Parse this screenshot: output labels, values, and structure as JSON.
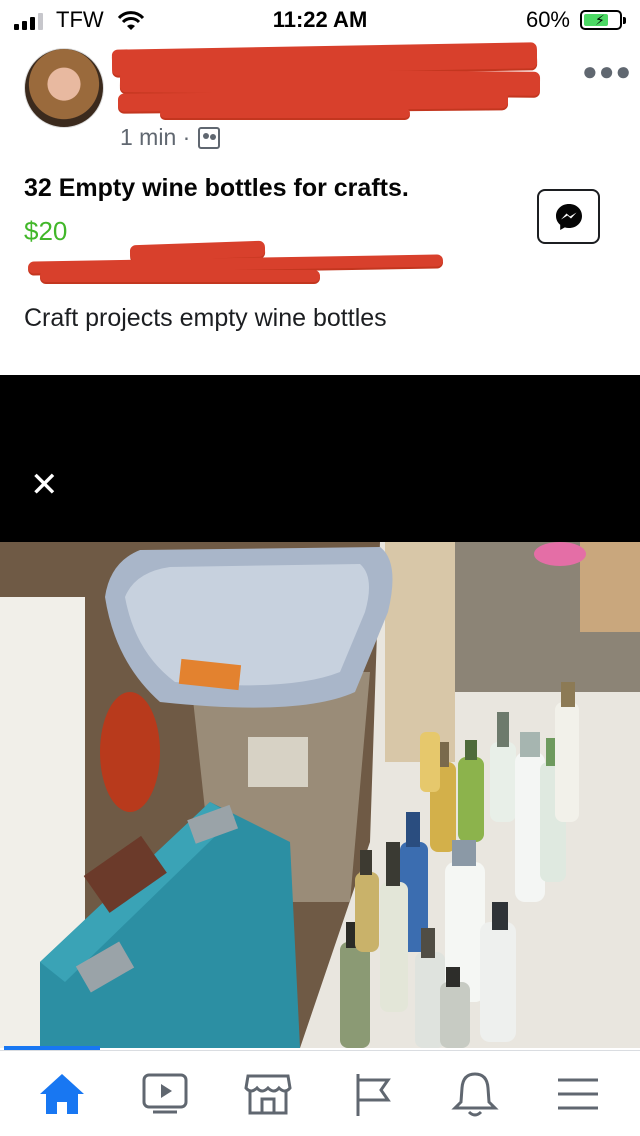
{
  "status_bar": {
    "carrier": "TFW",
    "time": "11:22 AM",
    "battery_percent": "60%"
  },
  "post": {
    "timestamp": "1 min ·",
    "title": "32 Empty wine bottles for crafts.",
    "price": "$20",
    "description": "Craft projects empty wine bottles"
  },
  "viewer": {
    "close_label": "✕"
  },
  "colors": {
    "price": "#42b72a",
    "accent": "#1877f2",
    "redaction": "#d8402c"
  },
  "bottom_nav": [
    "home-icon",
    "watch-icon",
    "marketplace-icon",
    "pages-icon",
    "notifications-icon",
    "menu-icon"
  ]
}
